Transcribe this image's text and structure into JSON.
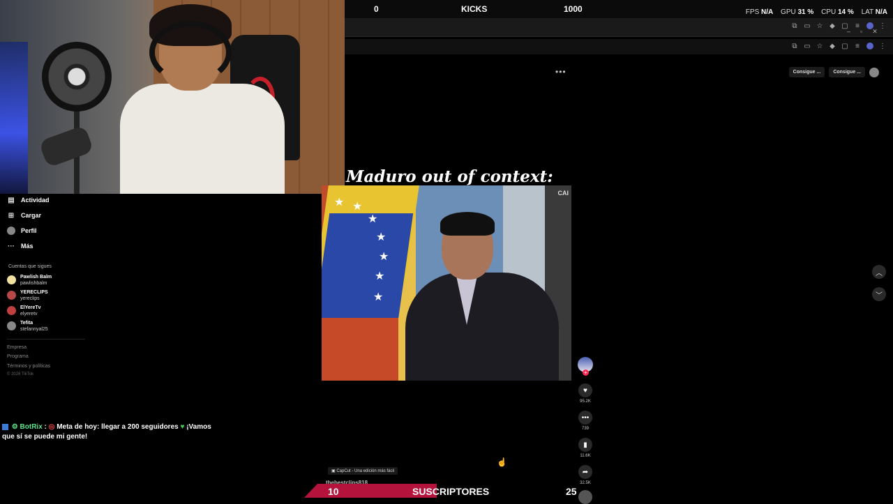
{
  "overlay": {
    "kicks": {
      "current": "0",
      "label": "KICKS",
      "goal": "1000"
    },
    "perf": {
      "fps_label": "FPS",
      "fps": "N/A",
      "gpu_label": "GPU",
      "gpu": "31 %",
      "cpu_label": "CPU",
      "cpu": "14 %",
      "lat_label": "LAT",
      "lat": "N/A"
    },
    "subs": {
      "current": "10",
      "label": "SUSCRIPTORES",
      "goal": "25"
    }
  },
  "tiktok": {
    "top_buttons": [
      "Consigue ...",
      "Consigue ..."
    ],
    "sidebar": {
      "nav": [
        {
          "label": "Actividad",
          "icon": "activity-icon"
        },
        {
          "label": "Cargar",
          "icon": "upload-icon"
        },
        {
          "label": "Perfil",
          "icon": "profile-icon"
        },
        {
          "label": "Más",
          "icon": "more-icon"
        }
      ],
      "following_title": "Cuentas que sigues",
      "following": [
        {
          "name": "Pawlish Balm",
          "user": "pawlishbalm",
          "color": "#f2e1a0"
        },
        {
          "name": "YERECLIPS",
          "user": "yereclips",
          "color": "#b84848"
        },
        {
          "name": "ElYereTv",
          "user": "elyeretv",
          "color": "#c04040"
        },
        {
          "name": "Tefita",
          "user": "stefannyal25",
          "color": "#888888"
        }
      ],
      "footer": [
        "Empresa",
        "Programa",
        "Términos y políticas",
        "© 2026 TikTok"
      ]
    },
    "video": {
      "title": "Maduro out of context:",
      "channel_logo": "CAI",
      "capcut": "CapCut - Una edición más fácil",
      "username": "thebestclips818"
    },
    "actions": {
      "likes": "95.2K",
      "comments": "739",
      "saves": "11.6K",
      "shares": "32.5K"
    }
  },
  "chat": {
    "user": "BotRix",
    "separator": ":",
    "message": "Meta de hoy: llegar a 200 seguidores",
    "message2": "¡Vamos que sí se puede mi gente!"
  },
  "colors": {
    "accent": "#b4143c",
    "like_red": "#fe2c55",
    "bot_green": "#5fe38d"
  }
}
